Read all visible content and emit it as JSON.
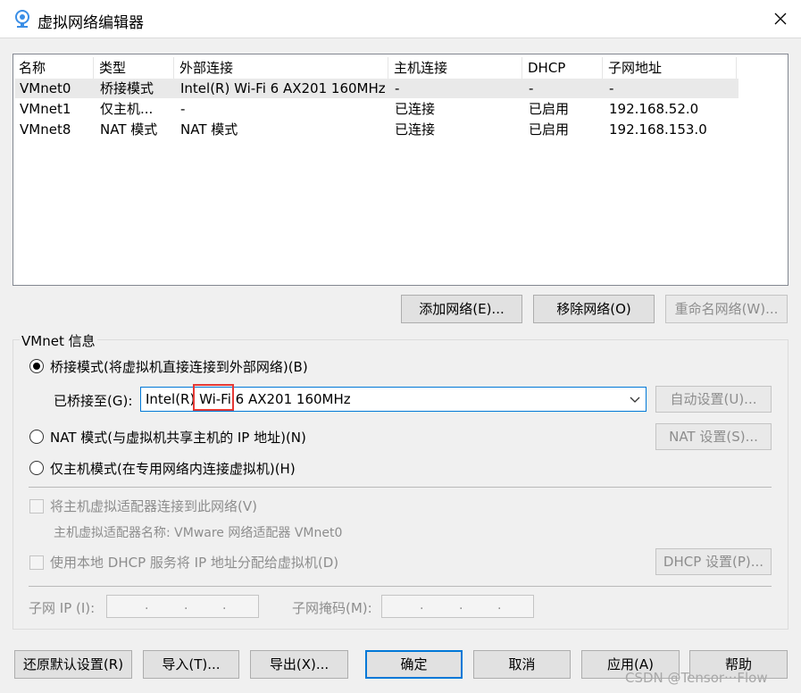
{
  "window": {
    "title": "虚拟网络编辑器",
    "icon": "network-editor-icon"
  },
  "list": {
    "headers": [
      "名称",
      "类型",
      "外部连接",
      "主机连接",
      "DHCP",
      "子网地址"
    ],
    "rows": [
      [
        "VMnet0",
        "桥接模式",
        "Intel(R) Wi-Fi 6 AX201 160MHz",
        "-",
        "-",
        "-"
      ],
      [
        "VMnet1",
        "仅主机...",
        "-",
        "已连接",
        "已启用",
        "192.168.52.0"
      ],
      [
        "VMnet8",
        "NAT 模式",
        "NAT 模式",
        "已连接",
        "已启用",
        "192.168.153.0"
      ]
    ],
    "selected_row": 0
  },
  "list_buttons": {
    "add": "添加网络(E)...",
    "remove": "移除网络(O)",
    "rename": "重命名网络(W)..."
  },
  "info": {
    "group_label": "VMnet 信息",
    "bridge_mode": "桥接模式(将虚拟机直接连接到外部网络)(B)",
    "bridged_to_label": "已桥接至(G):",
    "bridged_to_value": "Intel(R) Wi-Fi 6 AX201 160MHz",
    "auto_settings": "自动设置(U)...",
    "nat_mode": "NAT 模式(与虚拟机共享主机的 IP 地址)(N)",
    "nat_settings": "NAT 设置(S)...",
    "host_only_mode": "仅主机模式(在专用网络内连接虚拟机)(H)",
    "connect_adapter": "将主机虚拟适配器连接到此网络(V)",
    "adapter_name": "主机虚拟适配器名称: VMware 网络适配器 VMnet0",
    "use_dhcp": "使用本地 DHCP 服务将 IP 地址分配给虚拟机(D)",
    "dhcp_settings": "DHCP 设置(P)...",
    "subnet_ip_label": "子网 IP (I):",
    "subnet_mask_label": "子网掩码(M):",
    "ip_dot": "."
  },
  "footer": {
    "restore": "还原默认设置(R)",
    "import": "导入(T)...",
    "export": "导出(X)...",
    "ok": "确定",
    "cancel": "取消",
    "apply": "应用(A)",
    "help": "帮助"
  },
  "watermark": "CSDN @Tensor···Flow",
  "colors": {
    "accent": "#0078d7",
    "highlight_box": "#e53935",
    "selected_row": "#e9e9e9"
  }
}
